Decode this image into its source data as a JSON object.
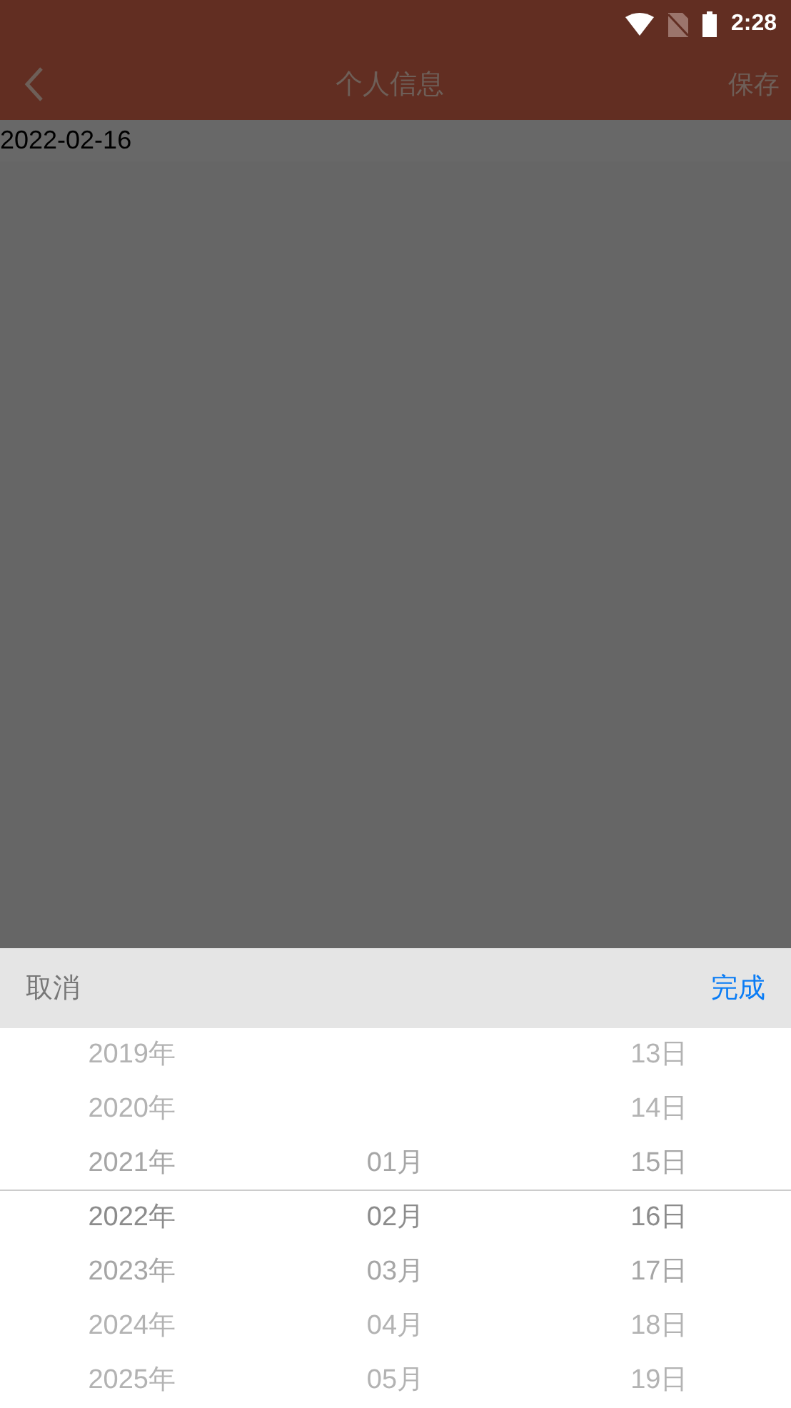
{
  "status_bar": {
    "time": "2:28"
  },
  "header": {
    "title": "个人信息",
    "action": "保存"
  },
  "date_field": {
    "value": "2022-02-16"
  },
  "picker": {
    "cancel": "取消",
    "confirm": "完成",
    "columns": [
      {
        "items": [
          {
            "label": "2019年",
            "selected": false
          },
          {
            "label": "2020年",
            "selected": false
          },
          {
            "label": "2021年",
            "selected": false
          },
          {
            "label": "2022年",
            "selected": true
          },
          {
            "label": "2023年",
            "selected": false
          },
          {
            "label": "2024年",
            "selected": false
          },
          {
            "label": "2025年",
            "selected": false
          }
        ]
      },
      {
        "items": [
          {
            "label": "01月",
            "selected": false
          },
          {
            "label": "02月",
            "selected": true
          },
          {
            "label": "03月",
            "selected": false
          },
          {
            "label": "04月",
            "selected": false
          },
          {
            "label": "05月",
            "selected": false
          }
        ]
      },
      {
        "items": [
          {
            "label": "13日",
            "selected": false
          },
          {
            "label": "14日",
            "selected": false
          },
          {
            "label": "15日",
            "selected": false
          },
          {
            "label": "16日",
            "selected": true
          },
          {
            "label": "17日",
            "selected": false
          },
          {
            "label": "18日",
            "selected": false
          },
          {
            "label": "19日",
            "selected": false
          }
        ]
      }
    ]
  }
}
